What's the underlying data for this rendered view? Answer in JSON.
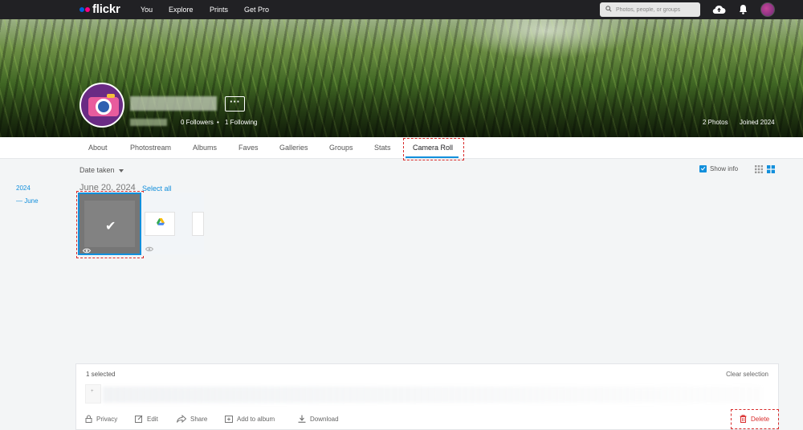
{
  "topbar": {
    "logo": "flickr",
    "nav": [
      "You",
      "Explore",
      "Prints",
      "Get Pro"
    ],
    "search_placeholder": "Photos, people, or groups"
  },
  "profile": {
    "followers": "0 Followers",
    "following": "1 Following",
    "photos": "2 Photos",
    "joined": "Joined 2024",
    "more_label": "···"
  },
  "subnav": {
    "tabs": [
      "About",
      "Photostream",
      "Albums",
      "Faves",
      "Galleries",
      "Groups",
      "Stats",
      "Camera Roll"
    ],
    "active": "Camera Roll"
  },
  "toolbar": {
    "sort_label": "Date taken",
    "show_info": "Show info"
  },
  "timeline": {
    "year": "2024",
    "month": "— June"
  },
  "day": {
    "heading": "June 20, 2024",
    "select_all": "Select all"
  },
  "panel": {
    "selected_count": "1 selected",
    "clear_selection": "Clear selection",
    "actions": [
      "Privacy",
      "Edit",
      "Share",
      "Add to album",
      "Download"
    ],
    "delete": "Delete"
  },
  "colors": {
    "accent": "#128fdc",
    "delete": "#d92b2b",
    "topbar": "#212124"
  },
  "icons": [
    "search-icon",
    "upload-cloud-icon",
    "bell-icon",
    "lock-icon",
    "edit-icon",
    "share-icon",
    "add-to-album-icon",
    "download-icon",
    "trash-icon",
    "grid-small-icon",
    "grid-large-icon",
    "eye-icon",
    "check-icon"
  ]
}
